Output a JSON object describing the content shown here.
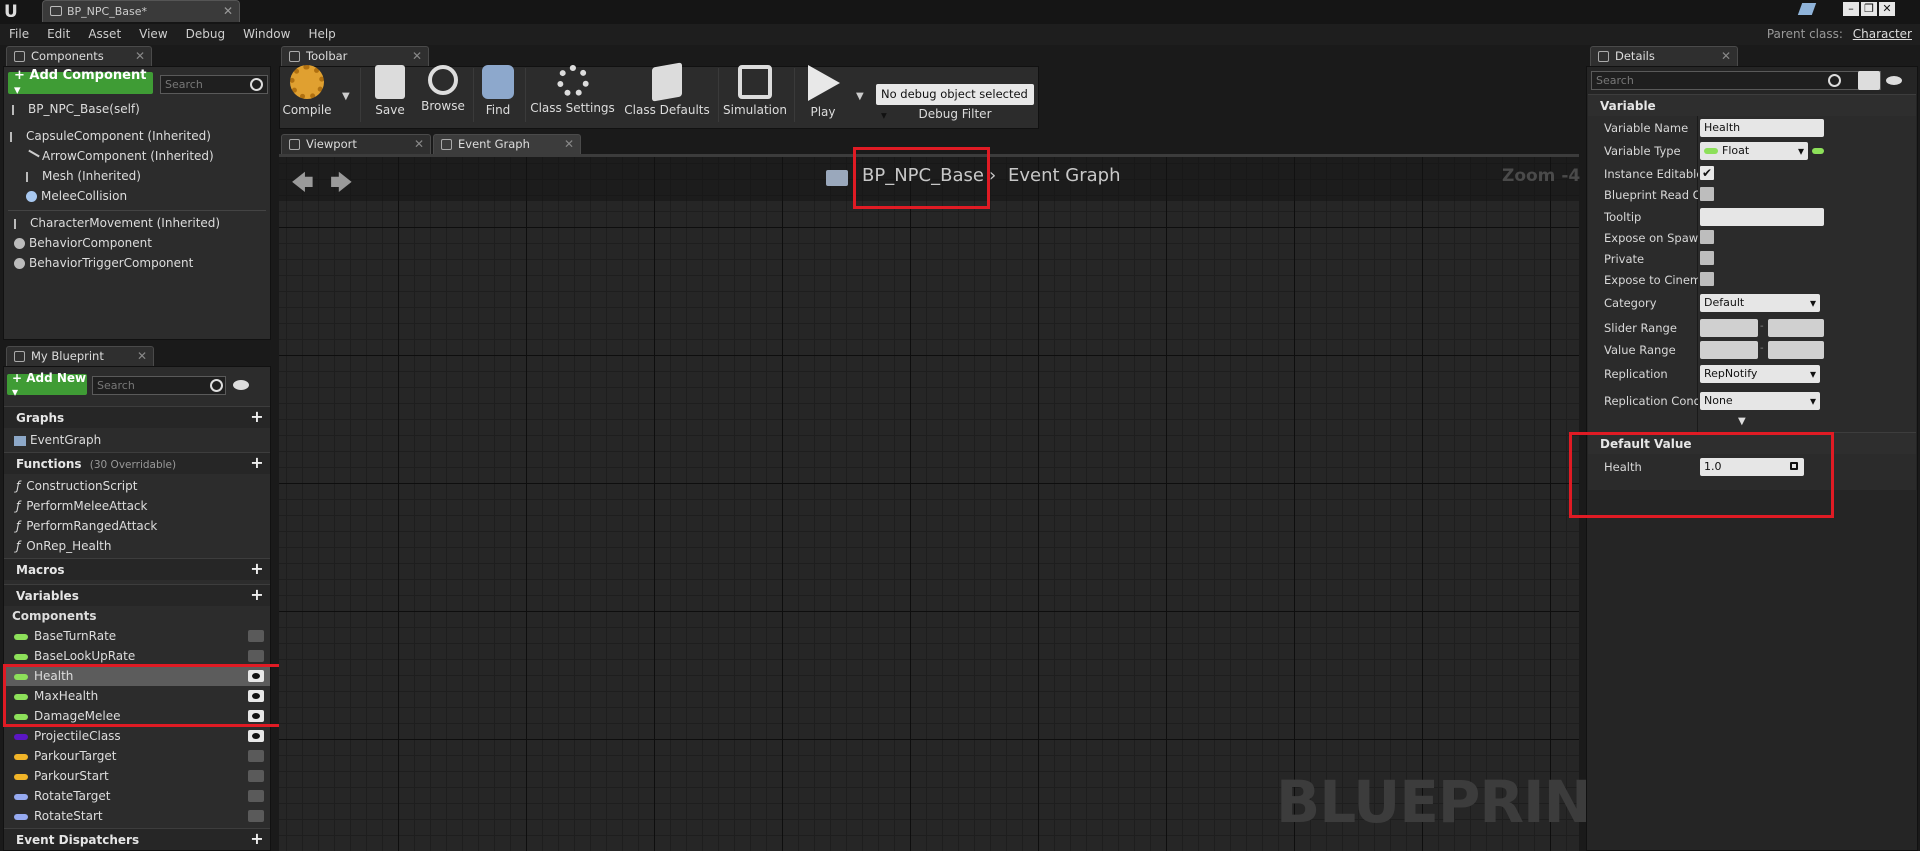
{
  "app": {
    "doc_tab": "BP_NPC_Base*",
    "parent_class_label": "Parent class:",
    "parent_class_value": "Character"
  },
  "menu": [
    "File",
    "Edit",
    "Asset",
    "View",
    "Debug",
    "Window",
    "Help"
  ],
  "components_panel": {
    "tab": "Components",
    "add_button": "+ Add Component ▾",
    "search_placeholder": "Search",
    "root": "BP_NPC_Base(self)",
    "items": [
      "CapsuleComponent (Inherited)",
      "ArrowComponent (Inherited)",
      "Mesh (Inherited)",
      "MeleeCollision",
      "CharacterMovement (Inherited)",
      "BehaviorComponent",
      "BehaviorTriggerComponent"
    ]
  },
  "my_blueprint": {
    "tab": "My Blueprint",
    "add_button": "+ Add New ▾",
    "search_placeholder": "Search",
    "graphs_label": "Graphs",
    "graphs": [
      "EventGraph"
    ],
    "functions_label": "Functions",
    "functions_count": "(30 Overridable)",
    "functions": [
      "ConstructionScript",
      "PerformMeleeAttack",
      "PerformRangedAttack",
      "OnRep_Health"
    ],
    "macros_label": "Macros",
    "variables_label": "Variables",
    "components_label": "Components",
    "variables": [
      {
        "name": "BaseTurnRate",
        "color": "#8de05a",
        "eye": false
      },
      {
        "name": "BaseLookUpRate",
        "color": "#8de05a",
        "eye": false
      },
      {
        "name": "Health",
        "color": "#8de05a",
        "eye": true
      },
      {
        "name": "MaxHealth",
        "color": "#8de05a",
        "eye": true
      },
      {
        "name": "DamageMelee",
        "color": "#8de05a",
        "eye": true
      },
      {
        "name": "ProjectileClass",
        "color": "#5b16c4",
        "eye": true
      },
      {
        "name": "ParkourTarget",
        "color": "#f0b428",
        "eye": false
      },
      {
        "name": "ParkourStart",
        "color": "#f0b428",
        "eye": false
      },
      {
        "name": "RotateTarget",
        "color": "#96aaf0",
        "eye": false
      },
      {
        "name": "RotateStart",
        "color": "#96aaf0",
        "eye": false
      }
    ],
    "dispatchers_label": "Event Dispatchers"
  },
  "toolbar": {
    "tab": "Toolbar",
    "buttons": [
      "Compile",
      "Save",
      "Browse",
      "Find",
      "Class Settings",
      "Class Defaults",
      "Simulation",
      "Play"
    ],
    "debug_select": "No debug object selected ▾",
    "debug_filter": "Debug Filter"
  },
  "graph_tabs": [
    "Viewport",
    "Event Graph"
  ],
  "graph": {
    "breadcrumb_root": "BP_NPC_Base",
    "breadcrumb_leaf": "Event Graph",
    "zoom": "Zoom -4",
    "watermark": "BLUEPRINT"
  },
  "details": {
    "tab": "Details",
    "search_placeholder": "Search",
    "variable_section": "Variable",
    "rows": {
      "variable_name_label": "Variable Name",
      "variable_name_value": "Health",
      "variable_type_label": "Variable Type",
      "variable_type_value": "Float",
      "instance_editable_label": "Instance Editable",
      "bp_readonly_label": "Blueprint Read Only",
      "tooltip_label": "Tooltip",
      "expose_spawn_label": "Expose on Spawn",
      "private_label": "Private",
      "expose_cinematics_label": "Expose to Cinematics",
      "category_label": "Category",
      "category_value": "Default",
      "slider_range_label": "Slider Range",
      "value_range_label": "Value Range",
      "replication_label": "Replication",
      "replication_value": "RepNotify",
      "replication_cond_label": "Replication Condition",
      "replication_cond_value": "None"
    },
    "default_section": "Default Value",
    "default_label": "Health",
    "default_value": "1.0"
  }
}
